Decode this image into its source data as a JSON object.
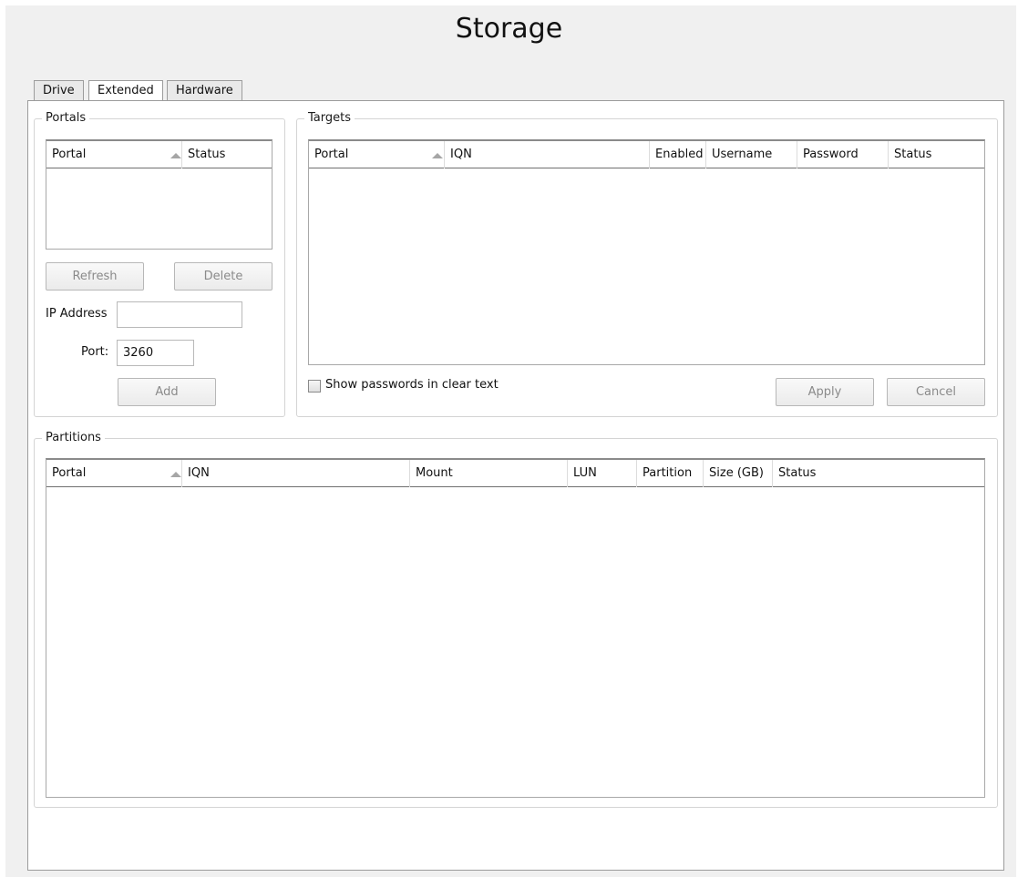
{
  "title": "Storage",
  "tabs": [
    "Drive",
    "Extended",
    "Hardware"
  ],
  "portals": {
    "title": "Portals",
    "columns": [
      "Portal",
      "Status"
    ],
    "refresh_label": "Refresh",
    "delete_label": "Delete",
    "ip_label": "IP Address",
    "ip_value": "",
    "port_label": "Port:",
    "port_value": "3260",
    "add_label": "Add"
  },
  "targets": {
    "title": "Targets",
    "columns": [
      "Portal",
      "IQN",
      "Enabled",
      "Username",
      "Password",
      "Status"
    ],
    "show_passwords_label": "Show passwords in clear text",
    "apply_label": "Apply",
    "cancel_label": "Cancel"
  },
  "partitions": {
    "title": "Partitions",
    "columns": [
      "Portal",
      "IQN",
      "Mount",
      "LUN",
      "Partition",
      "Size (GB)",
      "Status"
    ]
  },
  "icons": {
    "sort": "sort-ascending-icon"
  }
}
